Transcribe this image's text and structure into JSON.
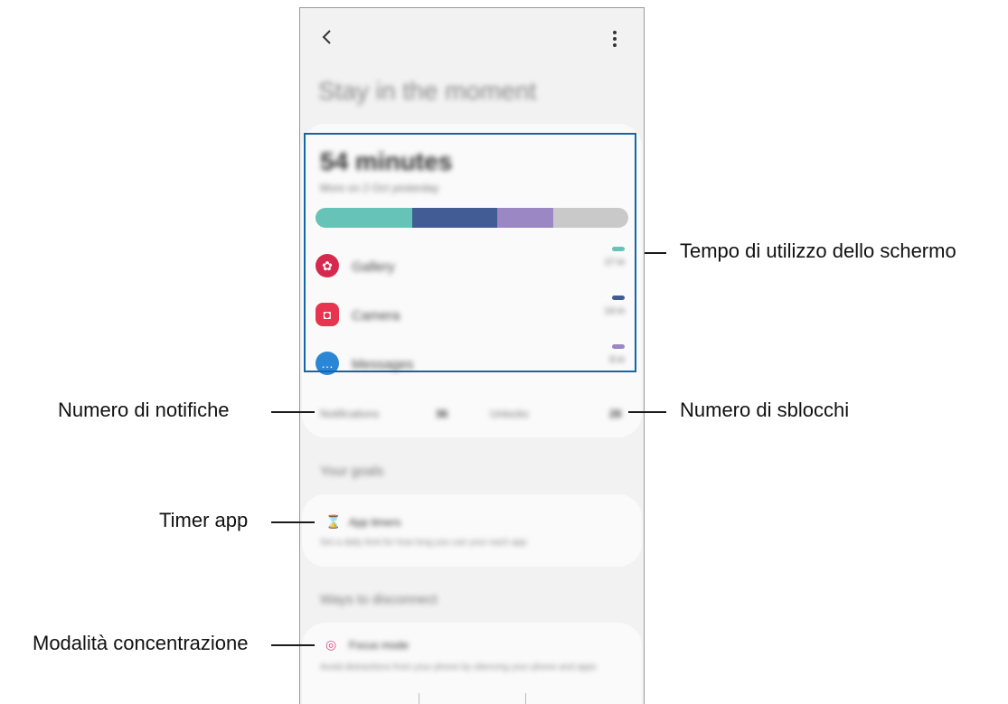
{
  "screen": {
    "page_title": "Stay in the moment",
    "back_icon": "chevron-left-icon",
    "more_icon": "more-vertical-icon"
  },
  "usage": {
    "total_time": "54 minutes",
    "subtitle": "More on 2 Oct yesterday",
    "bar_segments": [
      {
        "color": "#66c3b7",
        "fraction": 0.31
      },
      {
        "color": "#425c96",
        "fraction": 0.27
      },
      {
        "color": "#9a87c4",
        "fraction": 0.18
      },
      {
        "color": "#c9c9c9",
        "fraction": 0.24
      }
    ],
    "apps": [
      {
        "name": "Gallery",
        "time": "17 m",
        "icon": "gallery-flower-icon",
        "icon_color": "#d52a4e",
        "dash_color": "#66c3b7"
      },
      {
        "name": "Camera",
        "time": "14 m",
        "icon": "camera-icon",
        "icon_color": "#e8344f",
        "dash_color": "#425c96"
      },
      {
        "name": "Messages",
        "time": "9 m",
        "icon": "chat-bubble-icon",
        "icon_color": "#2c86d6",
        "dash_color": "#9a87c4"
      }
    ],
    "notifications_label": "Notifications",
    "notifications_value": "36",
    "unlocks_label": "Unlocks",
    "unlocks_value": "28"
  },
  "goals": {
    "section_title": "Your goals",
    "app_timers_title": "App timers",
    "app_timers_desc": "Set a daily limit for how long you use your each app",
    "icon": "hourglass-icon"
  },
  "disconnect": {
    "section_title": "Ways to disconnect",
    "focus_mode_title": "Focus mode",
    "focus_mode_desc": "Avoid distractions from your phone by silencing your phone and apps",
    "icon": "focus-target-icon"
  },
  "callouts": {
    "screen_time": "Tempo di utilizzo dello schermo",
    "notifications": "Numero di notifiche",
    "unlocks": "Numero di sblocchi",
    "app_timer": "Timer app",
    "focus_mode": "Modalità concentrazione"
  }
}
